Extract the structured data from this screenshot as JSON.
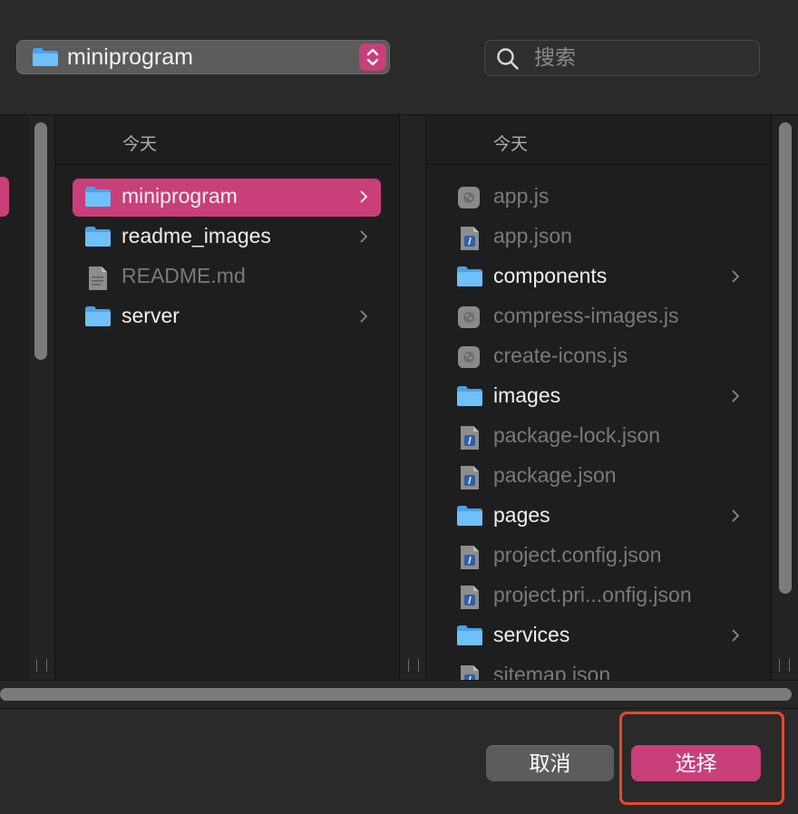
{
  "path_popup": {
    "label": "miniprogram"
  },
  "search": {
    "placeholder": "搜索",
    "value": ""
  },
  "columns": [
    {
      "header": "今天",
      "items": [
        {
          "name": "miniprogram",
          "kind": "folder",
          "selected": true,
          "dim": false
        },
        {
          "name": "readme_images",
          "kind": "folder",
          "selected": false,
          "dim": false
        },
        {
          "name": "README.md",
          "kind": "text-file",
          "selected": false,
          "dim": true
        },
        {
          "name": "server",
          "kind": "folder",
          "selected": false,
          "dim": false
        }
      ]
    },
    {
      "header": "今天",
      "items": [
        {
          "name": "app.js",
          "kind": "js-file",
          "dim": true
        },
        {
          "name": "app.json",
          "kind": "json-file",
          "dim": true
        },
        {
          "name": "components",
          "kind": "folder",
          "dim": false
        },
        {
          "name": "compress-images.js",
          "kind": "js-file",
          "dim": true
        },
        {
          "name": "create-icons.js",
          "kind": "js-file",
          "dim": true
        },
        {
          "name": "images",
          "kind": "folder",
          "dim": false
        },
        {
          "name": "package-lock.json",
          "kind": "json-file",
          "dim": true
        },
        {
          "name": "package.json",
          "kind": "json-file",
          "dim": true
        },
        {
          "name": "pages",
          "kind": "folder",
          "dim": false
        },
        {
          "name": "project.config.json",
          "kind": "json-file",
          "dim": true
        },
        {
          "name": "project.pri...onfig.json",
          "kind": "json-file",
          "dim": true
        },
        {
          "name": "services",
          "kind": "folder",
          "dim": false
        },
        {
          "name": "sitemap.json",
          "kind": "json-file",
          "dim": true
        }
      ]
    }
  ],
  "buttons": {
    "cancel": "取消",
    "choose": "选择"
  },
  "colors": {
    "accent": "#c93f79",
    "highlight": "#e84a2c",
    "folder": "#5ab0f2"
  }
}
